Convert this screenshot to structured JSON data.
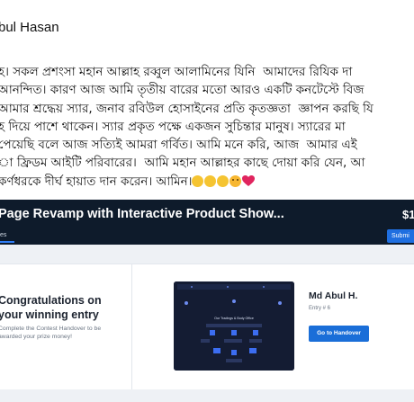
{
  "post": {
    "author_name": "bul Hasan",
    "lines": [
      "হ। সকল প্রশংসা মহান আল্লাহ রব্বুল আলামিনের যিনি  আমাদের রিযিক দা",
      "আনন্দিত। কারণ আজ আমি তৃতীয় বারের মতো আরও একটি কনটেস্টে বিজ",
      "আমার শ্রদ্ধেয় স্যার, জনাব রবিউল হোসাইনের প্রতি কৃতজ্ঞতা  জ্ঞাপন করছি যি",
      "হ দিয়ে পাশে থাকেন। স্যার প্রকৃত পক্ষে একজন সুচিন্তার মানুষ। স্যারের মা",
      "পেয়েছি বলে আজ সত্যিই আমরা গর্বিত। আমি মনে করি, আজ  আমার এই",
      "া ফ্রিডম আইটি পরিবারের।  আমি মহান আল্লাহর কাছে দোয়া করি যেন, আ",
      "কর্ণধরকে দীর্ঘ হায়াত দান করেন। আমিন।"
    ],
    "emojis": [
      "clapping-hands",
      "clapping-hands",
      "clapping-hands",
      "smiling-face-with-hearts",
      "red-heart"
    ]
  },
  "contest_card": {
    "title": "Page Revamp with Interactive Product Show...",
    "prize": "$1",
    "tab_label": "es",
    "submit_label": "Submi",
    "congrats_title_line1": "Congratulations on",
    "congrats_title_line2": "your winning entry",
    "congrats_desc_line1": "Complete the Contest Handover to be",
    "congrats_desc_line2": "awarded your prize money!",
    "winner_name": "Md Abul H.",
    "entry_label": "Entry # 6",
    "handover_label": "Go to Handover",
    "thumbnail_heading": "Our Tradings & Body Office"
  },
  "colors": {
    "card_header_bg": "#0e1b2b",
    "accent_blue": "#1a6ed8",
    "card_body_bg": "#eef1f5",
    "heart": "#e0245e"
  }
}
